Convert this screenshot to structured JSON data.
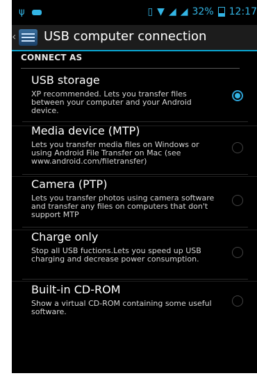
{
  "status_bar": {
    "left_icons": [
      "usb-icon",
      "notification-icon"
    ],
    "right_icons": [
      "vibrate-icon",
      "wifi-icon",
      "signal-icon",
      "signal-icon",
      "battery-icon"
    ],
    "battery": "32%",
    "time": "12:17"
  },
  "header": {
    "title": "USB computer connection"
  },
  "section": {
    "label": "CONNECT AS"
  },
  "options": [
    {
      "title": "USB storage",
      "description": "XP recommended. Lets you transfer files between your computer and your Android device.",
      "selected": true
    },
    {
      "title": "Media device (MTP)",
      "description": "Lets you transfer media files on Windows or using Android File Transfer on Mac (see www.android.com/filetransfer)",
      "selected": false
    },
    {
      "title": "Camera (PTP)",
      "description": "Lets you transfer photos using camera software and transfer any files on computers that don't support MTP",
      "selected": false
    },
    {
      "title": "Charge only",
      "description": "Stop all USB fuctions.Lets you speed up USB charging and decrease power consumption.",
      "selected": false
    },
    {
      "title": "Built-in CD-ROM",
      "description": "Show a virtual CD-ROM containing some useful software.",
      "selected": false
    }
  ],
  "colors": {
    "accent": "#33b5e5",
    "background": "#000000",
    "title_bar": "#1c1c1c"
  }
}
